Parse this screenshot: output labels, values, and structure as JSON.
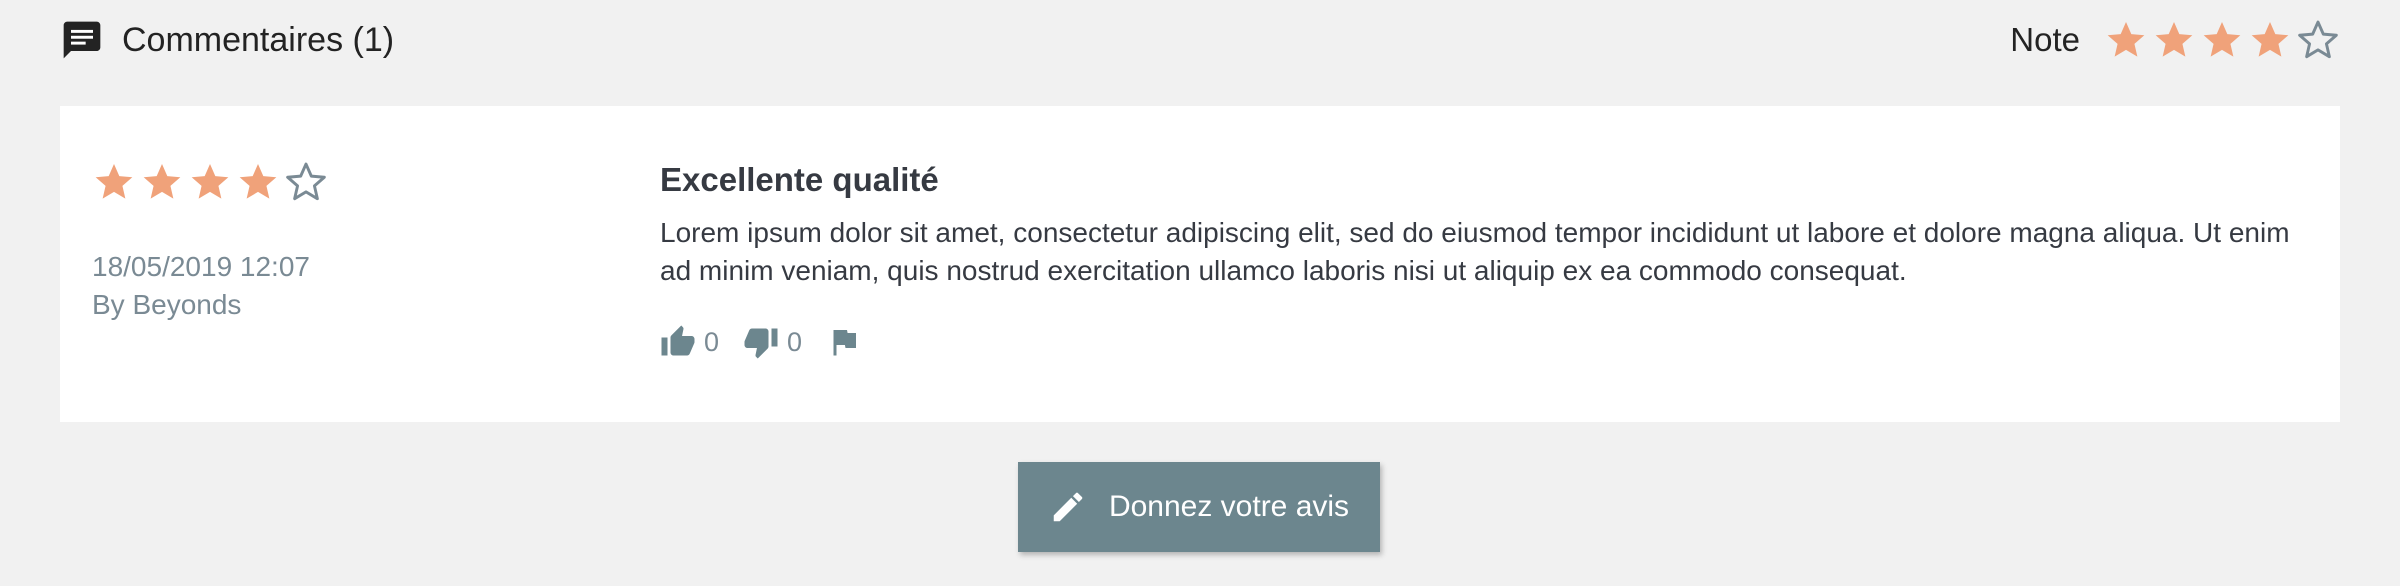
{
  "header": {
    "title": "Commentaires (1)",
    "icon": "comment-icon",
    "note_label": "Note",
    "rating": 4,
    "rating_max": 5
  },
  "review": {
    "rating": 4,
    "rating_max": 5,
    "date": "18/05/2019 12:07",
    "author": "By Beyonds",
    "title": "Excellente qualité",
    "body": "Lorem ipsum dolor sit amet, consectetur adipiscing elit, sed do eiusmod tempor incididunt ut labore et dolore magna aliqua. Ut enim ad minim veniam, quis nostrud exercitation ullamco laboris nisi ut aliquip ex ea commodo consequat.",
    "useful_count": "0",
    "not_useful_count": "0",
    "actions": {
      "useful_icon": "thumbs-up-icon",
      "not_useful_icon": "thumbs-down-icon",
      "report_icon": "flag-icon"
    }
  },
  "cta": {
    "label": "Donnez votre avis",
    "icon": "pencil-icon"
  },
  "colors": {
    "star_filled": "#f0a27a",
    "star_empty": "#7a8a94",
    "button_bg": "#6c868e",
    "background": "#f1f1f1",
    "muted_text": "#7a8a94"
  }
}
